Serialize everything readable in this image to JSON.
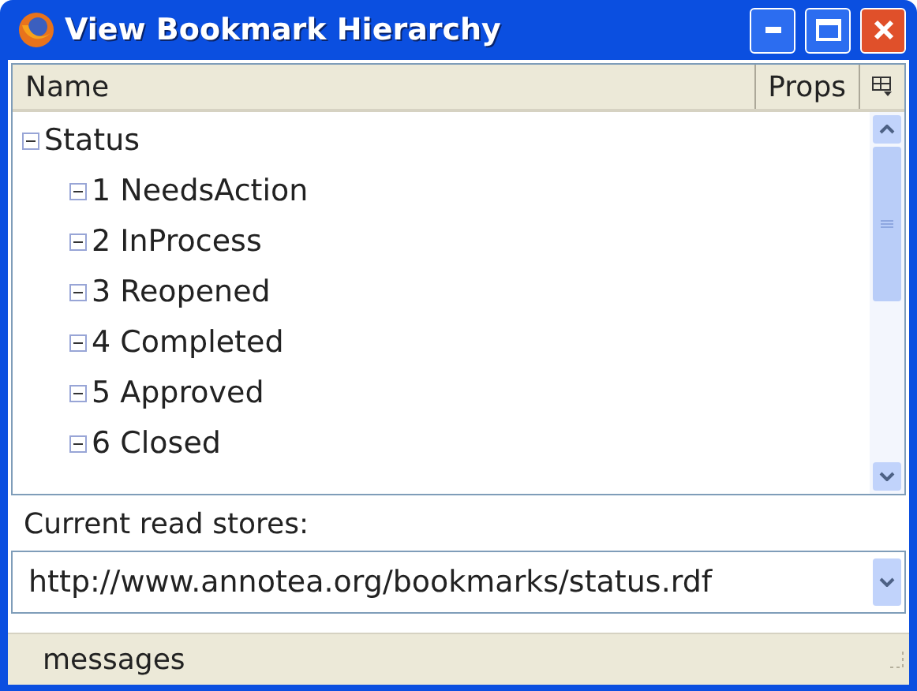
{
  "window": {
    "title": "View Bookmark Hierarchy"
  },
  "tree": {
    "columns": [
      "Name",
      "Props"
    ],
    "items": [
      {
        "label": "Status",
        "expanded": true,
        "children": [
          {
            "label": "1 NeedsAction",
            "expanded": true
          },
          {
            "label": "2 InProcess",
            "expanded": true
          },
          {
            "label": "3 Reopened",
            "expanded": true
          },
          {
            "label": "4 Completed",
            "expanded": true
          },
          {
            "label": "5 Approved",
            "expanded": true
          },
          {
            "label": "6 Closed",
            "expanded": true
          }
        ]
      }
    ]
  },
  "stores": {
    "label": "Current read stores:",
    "value": "http://www.annotea.org/bookmarks/status.rdf"
  },
  "status_bar": {
    "text": "messages"
  }
}
